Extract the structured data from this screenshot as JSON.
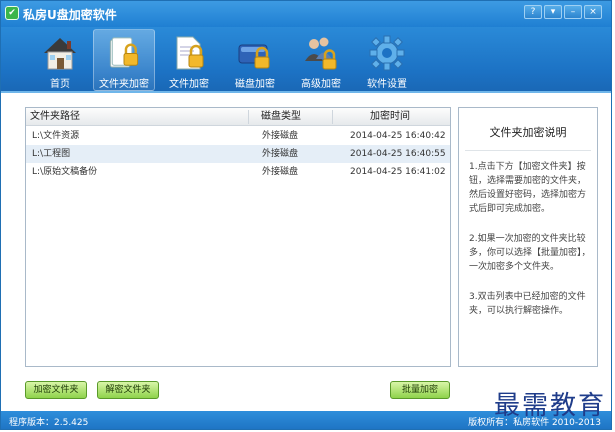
{
  "window": {
    "title": "私房U盘加密软件"
  },
  "title_controls": [
    "?",
    "▾",
    "–",
    "×"
  ],
  "toolbar": {
    "items": [
      {
        "label": "首页",
        "icon": "house-icon",
        "active": false
      },
      {
        "label": "文件夹加密",
        "icon": "folder-lock-icon",
        "active": true
      },
      {
        "label": "文件加密",
        "icon": "file-lock-icon",
        "active": false
      },
      {
        "label": "磁盘加密",
        "icon": "disk-lock-icon",
        "active": false
      },
      {
        "label": "高级加密",
        "icon": "users-lock-icon",
        "active": false
      },
      {
        "label": "软件设置",
        "icon": "gear-icon",
        "active": false
      }
    ]
  },
  "table": {
    "headers": [
      "文件夹路径",
      "磁盘类型",
      "加密时间"
    ],
    "rows": [
      {
        "path": "L:\\文件资源",
        "type": "外接磁盘",
        "time": "2014-04-25 16:40:42",
        "selected": false
      },
      {
        "path": "L:\\工程图",
        "type": "外接磁盘",
        "time": "2014-04-25 16:40:55",
        "selected": true
      },
      {
        "path": "L:\\原始文稿备份",
        "type": "外接磁盘",
        "time": "2014-04-25 16:41:02",
        "selected": false
      }
    ]
  },
  "info": {
    "title": "文件夹加密说明",
    "p1": "1.点击下方【加密文件夹】按钮，选择需要加密的文件夹，然后设置好密码，选择加密方式后即可完成加密。",
    "p2": "2.如果一次加密的文件夹比较多，你可以选择【批量加密】，一次加密多个文件夹。",
    "p3": "3.双击列表中已经加密的文件夹，可以执行解密操作。"
  },
  "buttons": {
    "encrypt": "加密文件夹",
    "decrypt": "解密文件夹",
    "batch": "批量加密"
  },
  "status": {
    "version": "程序版本：2.5.425",
    "copyright": "版权所有：私房软件 2010-2013"
  },
  "watermark": "最需教育",
  "colors": {
    "accent": "#1f7fd2",
    "button_green": "#8fd34b",
    "selected_row": "#e5eef7"
  }
}
